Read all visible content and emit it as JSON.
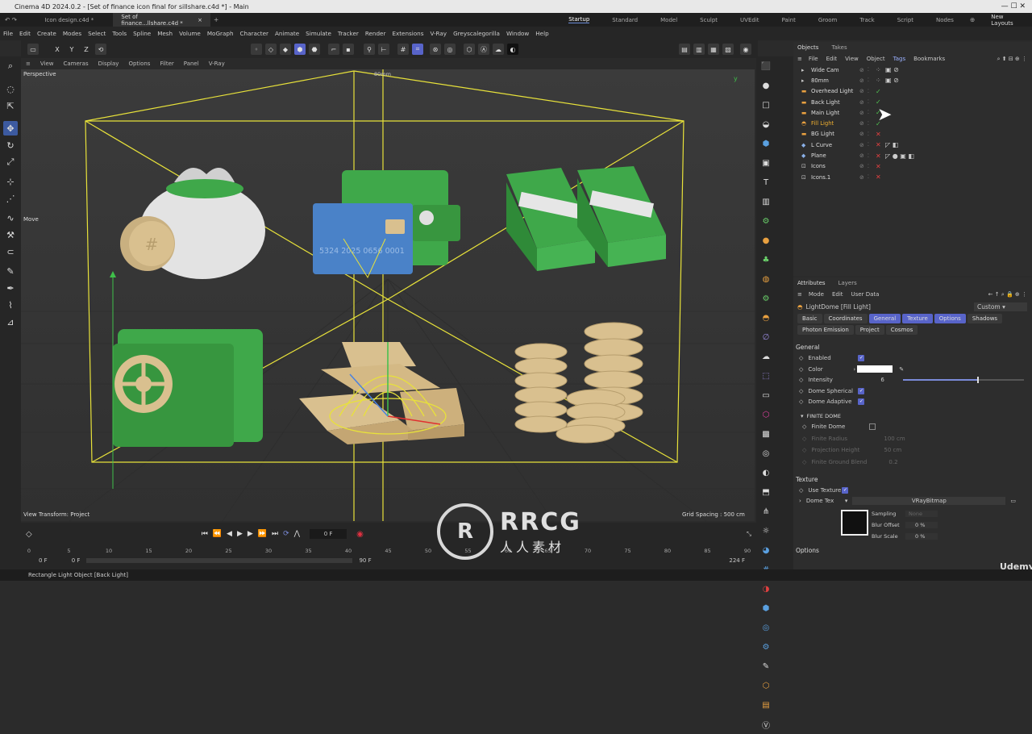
{
  "titlebar": {
    "title": "Cinema 4D 2024.0.2 - [Set of finance icon final for sillshare.c4d *] - Main"
  },
  "tabs": {
    "file1": "Icon design.c4d *",
    "file2": "Set of finance...llshare.c4d *",
    "layouts": [
      "Startup",
      "Standard",
      "Model",
      "Sculpt",
      "UVEdit",
      "Paint",
      "Groom",
      "Track",
      "Script",
      "Nodes"
    ],
    "active_layout": "Startup",
    "new_layouts": "New Layouts"
  },
  "menu": [
    "File",
    "Edit",
    "Create",
    "Modes",
    "Select",
    "Tools",
    "Spline",
    "Mesh",
    "Volume",
    "MoGraph",
    "Character",
    "Animate",
    "Simulate",
    "Tracker",
    "Render",
    "Extensions",
    "V-Ray",
    "Greyscalegorilla",
    "Window",
    "Help"
  ],
  "toolbar": {
    "x": "X",
    "y": "Y",
    "z": "Z"
  },
  "viewport": {
    "menu": [
      "View",
      "Cameras",
      "Display",
      "Options",
      "Filter",
      "Panel",
      "V-Ray"
    ],
    "name": "Perspective",
    "camera": "80mm",
    "move_label": "Move",
    "view_transform": "View Transform: Project",
    "grid_spacing": "Grid Spacing : 500 cm",
    "card_number": "5324 2025 0656 0001"
  },
  "timeline": {
    "frame": "0 F",
    "ruler": [
      "0",
      "5",
      "10",
      "15",
      "20",
      "25",
      "30",
      "35",
      "40",
      "45",
      "50",
      "55",
      "60",
      "65",
      "70",
      "75",
      "80",
      "85",
      "90"
    ],
    "start": "0 F",
    "start2": "0 F",
    "end": "90 F",
    "end2": "224 F"
  },
  "status": "Rectangle Light Object [Back Light]",
  "objects": {
    "tabs": [
      "Objects",
      "Takes"
    ],
    "menu": [
      "File",
      "Edit",
      "View",
      "Object",
      "Tags",
      "Bookmarks"
    ],
    "items": [
      {
        "name": "Wide Cam",
        "icon": "camera-icon",
        "status": "grey"
      },
      {
        "name": "80mm",
        "icon": "camera-icon",
        "status": "grey"
      },
      {
        "name": "Overhead Light",
        "icon": "light-icon",
        "status": "check"
      },
      {
        "name": "Back Light",
        "icon": "light-icon",
        "status": "check"
      },
      {
        "name": "Main Light",
        "icon": "light-icon",
        "status": "check"
      },
      {
        "name": "Fill Light",
        "icon": "dome-light-icon",
        "status": "check",
        "selected": true
      },
      {
        "name": "BG Light",
        "icon": "light-icon",
        "status": "x"
      },
      {
        "name": "L Curve",
        "icon": "curve-icon",
        "status": "x"
      },
      {
        "name": "Plane",
        "icon": "plane-icon",
        "status": "x"
      },
      {
        "name": "Icons",
        "icon": "null-icon",
        "status": "x"
      },
      {
        "name": "Icons.1",
        "icon": "null-icon",
        "status": "x"
      }
    ]
  },
  "attributes": {
    "tabs": [
      "Attributes",
      "Layers"
    ],
    "menu": [
      "Mode",
      "Edit",
      "User Data"
    ],
    "object_name": "LightDome [Fill Light]",
    "preset": "Custom",
    "tabs_row1": [
      "Basic",
      "Coordinates",
      "General",
      "Texture",
      "Options",
      "Shadows"
    ],
    "tabs_row2": [
      "Photon Emission",
      "Project",
      "Cosmos"
    ],
    "section_general": "General",
    "enabled": "Enabled",
    "color": "Color",
    "intensity": "Intensity",
    "intensity_value": "6",
    "dome_spherical": "Dome Spherical",
    "dome_adaptive": "Dome Adaptive",
    "finite_header": "FINITE DOME",
    "finite_dome": "Finite Dome",
    "finite_radius": "Finite Radius",
    "finite_radius_val": "100 cm",
    "projection_height": "Projection Height",
    "projection_height_val": "50 cm",
    "ground_blend": "Finite Ground Blend",
    "ground_blend_val": "0.2",
    "section_texture": "Texture",
    "use_texture": "Use Texture",
    "dome_tex": "Dome Tex",
    "dome_tex_val": "VRayBitmap",
    "sampling": "Sampling",
    "sampling_val": "None",
    "blur_offset": "Blur Offset",
    "blur_offset_val": "0 %",
    "blur_scale": "Blur Scale",
    "blur_scale_val": "0 %",
    "section_options": "Options"
  },
  "watermark": {
    "main": "RRCG",
    "sub": "人人素材",
    "brand": "Udemy"
  },
  "colors": {
    "accent": "#5864c9",
    "selection_yellow": "#e8e23a",
    "card_blue": "#4a82c8",
    "green": "#3fa84a",
    "gold": "#d9c08f"
  }
}
